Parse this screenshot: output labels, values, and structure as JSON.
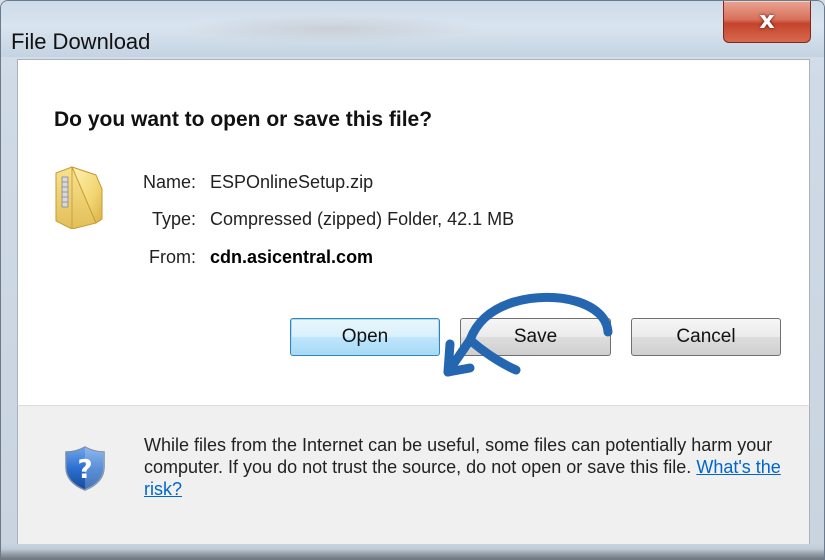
{
  "window": {
    "title": "File Download",
    "close_glyph": "x"
  },
  "dialog": {
    "question": "Do you want to open or save this file?",
    "file": {
      "name_label": "Name:",
      "name_value": "ESPOnlineSetup.zip",
      "type_label": "Type:",
      "type_value": "Compressed (zipped) Folder, 42.1 MB",
      "from_label": "From:",
      "from_value": "cdn.asicentral.com",
      "icon": "zip-folder-icon"
    },
    "buttons": {
      "open": "Open",
      "save": "Save",
      "cancel": "Cancel"
    },
    "annotation": {
      "icon": "curved-arrow-icon",
      "color": "#2566b0"
    }
  },
  "footer": {
    "icon": "shield-question-icon",
    "warning_text": "While files from the Internet can be useful, some files can potentially harm your computer. If you do not trust the source, do not open or save this file.",
    "risk_link": "What's the risk?"
  },
  "colors": {
    "accent": "#2566b0",
    "link": "#0066cc",
    "close_button": "#c5432c",
    "default_button": "#bee6fd"
  }
}
